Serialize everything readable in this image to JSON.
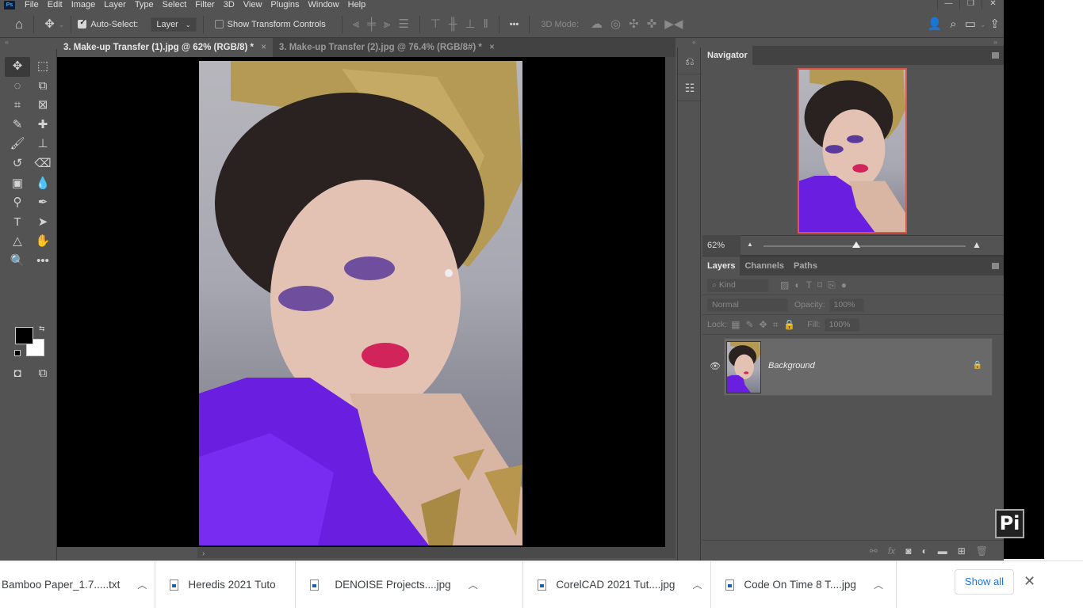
{
  "app": {
    "logo": "Ps",
    "menu": [
      "File",
      "Edit",
      "Image",
      "Layer",
      "Type",
      "Select",
      "Filter",
      "3D",
      "View",
      "Plugins",
      "Window",
      "Help"
    ],
    "window_controls": {
      "minimize": "—",
      "restore": "❐",
      "close": "✕"
    }
  },
  "options_bar": {
    "auto_select_label": "Auto-Select:",
    "auto_select_checked": true,
    "auto_select_target": "Layer",
    "show_transform_label": "Show Transform Controls",
    "show_transform_checked": false,
    "more_label": "•••",
    "mode_3d_label": "3D Mode:"
  },
  "documents": {
    "tabs": [
      {
        "label": "3. Make-up Transfer (1).jpg @ 62% (RGB/8) *",
        "active": true,
        "close": "×"
      },
      {
        "label": "3. Make-up Transfer (2).jpg @ 76.4% (RGB/8#) *",
        "active": false,
        "close": "×"
      }
    ]
  },
  "toolbar": {
    "tools": [
      {
        "name": "move-tool",
        "glyph": "✥"
      },
      {
        "name": "marquee-tool",
        "glyph": "⬚"
      },
      {
        "name": "lasso-tool",
        "glyph": "◌"
      },
      {
        "name": "object-select-tool",
        "glyph": "⧉"
      },
      {
        "name": "crop-tool",
        "glyph": "⌗"
      },
      {
        "name": "frame-tool",
        "glyph": "⊠"
      },
      {
        "name": "eyedropper-tool",
        "glyph": "✎"
      },
      {
        "name": "healing-brush-tool",
        "glyph": "✚"
      },
      {
        "name": "brush-tool",
        "glyph": "🖌"
      },
      {
        "name": "clone-stamp-tool",
        "glyph": "⊥"
      },
      {
        "name": "history-brush-tool",
        "glyph": "↺"
      },
      {
        "name": "eraser-tool",
        "glyph": "⌫"
      },
      {
        "name": "gradient-tool",
        "glyph": "▣"
      },
      {
        "name": "blur-tool",
        "glyph": "💧"
      },
      {
        "name": "dodge-tool",
        "glyph": "⚲"
      },
      {
        "name": "pen-tool",
        "glyph": "✒"
      },
      {
        "name": "type-tool",
        "glyph": "T"
      },
      {
        "name": "path-select-tool",
        "glyph": "➤"
      },
      {
        "name": "shape-tool",
        "glyph": "△"
      },
      {
        "name": "hand-tool",
        "glyph": "✋"
      },
      {
        "name": "zoom-tool",
        "glyph": "🔍"
      },
      {
        "name": "more-tools",
        "glyph": "•••"
      }
    ],
    "foreground_color": "#000000",
    "background_color": "#ffffff"
  },
  "navigator": {
    "title": "Navigator",
    "zoom": "62%",
    "zoom_slider_fraction": 0.46
  },
  "layers_panel": {
    "tabs": [
      "Layers",
      "Channels",
      "Paths"
    ],
    "active_tab": "Layers",
    "filter_placeholder": "Kind",
    "blend_mode": "Normal",
    "opacity_label": "Opacity:",
    "opacity": "100%",
    "lock_label": "Lock:",
    "fill_label": "Fill:",
    "fill": "100%",
    "layers": [
      {
        "name": "Background",
        "visible": true,
        "locked": true
      }
    ]
  },
  "downloads": {
    "items": [
      {
        "name": "Bamboo Paper_1.7.....txt",
        "has_icon": false,
        "has_chevron": true
      },
      {
        "name": "Heredis 2021 Tuto",
        "has_icon": true,
        "has_chevron": false
      },
      {
        "name": "DENOISE Projects....jpg",
        "has_icon": true,
        "has_chevron": true
      },
      {
        "name": "CorelCAD 2021 Tut....jpg",
        "has_icon": true,
        "has_chevron": true
      },
      {
        "name": "Code On Time 8 T....jpg",
        "has_icon": true,
        "has_chevron": true
      }
    ],
    "show_all": "Show all",
    "close": "✕"
  },
  "watermark": "Pi"
}
